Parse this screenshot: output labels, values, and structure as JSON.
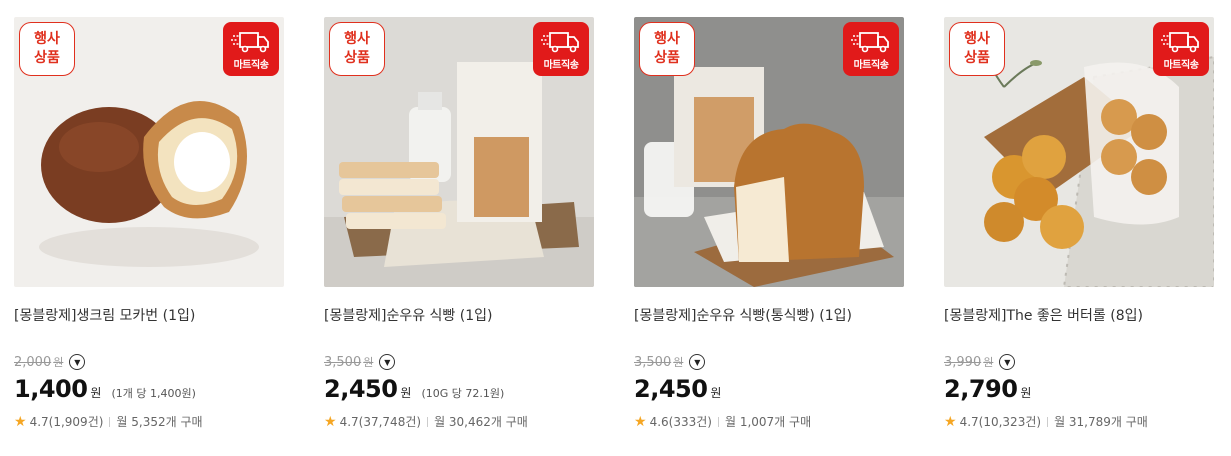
{
  "products": [
    {
      "event_badge": [
        "행사",
        "상품"
      ],
      "ship_badge": "마트직송",
      "title": "[몽블랑제]생크림 모카번 (1입)",
      "original_price": "2,000",
      "original_unit": "원",
      "price": "1,400",
      "price_unit": "원",
      "unit_price": "(1개 당 1,400원)",
      "rating": "4.7",
      "review_count": "(1,909건)",
      "monthly_sales": "월 5,352개 구매"
    },
    {
      "event_badge": [
        "행사",
        "상품"
      ],
      "ship_badge": "마트직송",
      "title": "[몽블랑제]순우유 식빵 (1입)",
      "original_price": "3,500",
      "original_unit": "원",
      "price": "2,450",
      "price_unit": "원",
      "unit_price": "(10G 당 72.1원)",
      "rating": "4.7",
      "review_count": "(37,748건)",
      "monthly_sales": "월 30,462개 구매"
    },
    {
      "event_badge": [
        "행사",
        "상품"
      ],
      "ship_badge": "마트직송",
      "title": "[몽블랑제]순우유 식빵(통식빵) (1입)",
      "original_price": "3,500",
      "original_unit": "원",
      "price": "2,450",
      "price_unit": "원",
      "unit_price": "",
      "rating": "4.6",
      "review_count": "(333건)",
      "monthly_sales": "월 1,007개 구매"
    },
    {
      "event_badge": [
        "행사",
        "상품"
      ],
      "ship_badge": "마트직송",
      "title": "[몽블랑제]The 좋은 버터롤 (8입)",
      "original_price": "3,990",
      "original_unit": "원",
      "price": "2,790",
      "price_unit": "원",
      "unit_price": "",
      "rating": "4.7",
      "review_count": "(10,323건)",
      "monthly_sales": "월 31,789개 구매"
    }
  ],
  "icons": {
    "info": "chevron-down-icon",
    "rating": "star-icon",
    "shipping": "truck-icon"
  },
  "colors": {
    "badge_red": "#e11a1a",
    "star": "#f5a623",
    "strike": "#999999"
  }
}
